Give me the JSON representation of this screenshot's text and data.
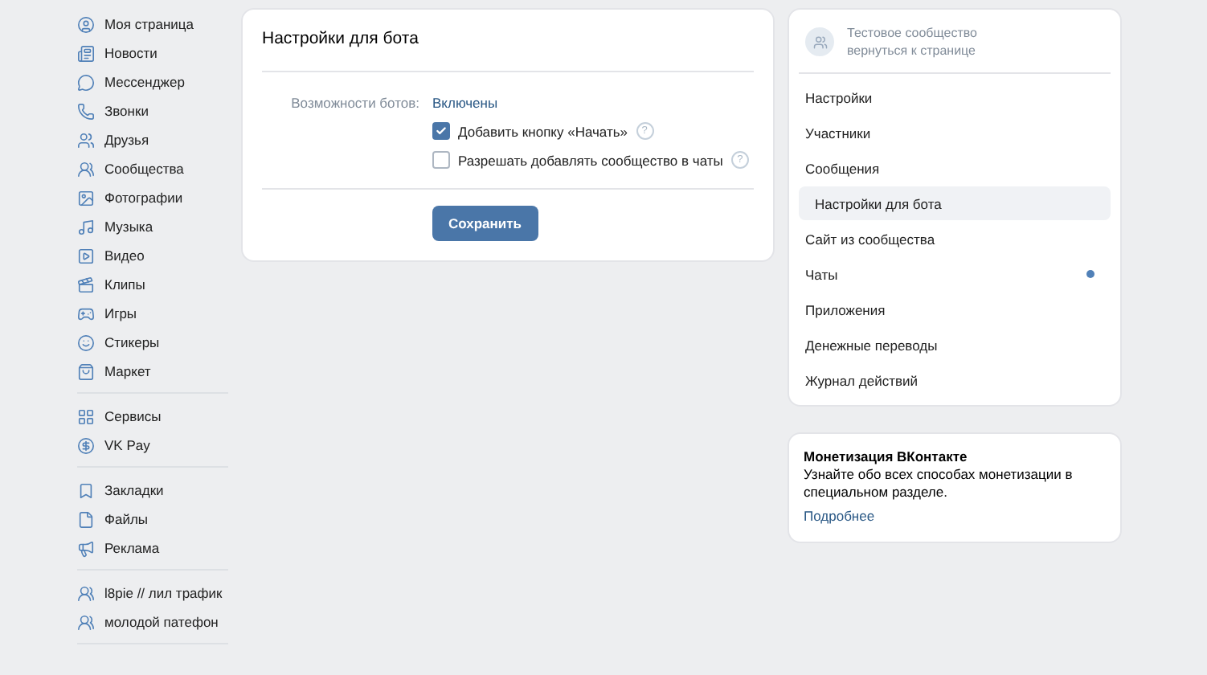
{
  "sidebar": {
    "groups": [
      {
        "items": [
          {
            "label": "Моя страница"
          },
          {
            "label": "Новости"
          },
          {
            "label": "Мессенджер"
          },
          {
            "label": "Звонки"
          },
          {
            "label": "Друзья"
          },
          {
            "label": "Сообщества"
          },
          {
            "label": "Фотографии"
          },
          {
            "label": "Музыка"
          },
          {
            "label": "Видео"
          },
          {
            "label": "Клипы"
          },
          {
            "label": "Игры"
          },
          {
            "label": "Стикеры"
          },
          {
            "label": "Маркет"
          }
        ]
      },
      {
        "items": [
          {
            "label": "Сервисы"
          },
          {
            "label": "VK Pay"
          }
        ]
      },
      {
        "items": [
          {
            "label": "Закладки"
          },
          {
            "label": "Файлы"
          },
          {
            "label": "Реклама"
          }
        ]
      },
      {
        "items": [
          {
            "label": "l8pie // лил трафик"
          },
          {
            "label": "молодой патефон"
          }
        ]
      }
    ]
  },
  "bot_settings": {
    "title": "Настройки для бота",
    "field_label": "Возможности ботов:",
    "field_value": "Включены",
    "options": [
      {
        "label": "Добавить кнопку «Начать»",
        "checked": true,
        "help": "?"
      },
      {
        "label": "Разрешать добавлять сообщество в чаты",
        "checked": false,
        "help": "?"
      }
    ],
    "save_button": "Сохранить"
  },
  "community": {
    "name": "Тестовое сообщество",
    "back_link": "вернуться к странице",
    "menu": [
      {
        "label": "Настройки",
        "selected": false,
        "unread": false
      },
      {
        "label": "Участники",
        "selected": false,
        "unread": false
      },
      {
        "label": "Сообщения",
        "selected": false,
        "unread": false
      },
      {
        "label": "Настройки для бота",
        "selected": true,
        "unread": false
      },
      {
        "label": "Сайт из сообщества",
        "selected": false,
        "unread": false
      },
      {
        "label": "Чаты",
        "selected": false,
        "unread": true
      },
      {
        "label": "Приложения",
        "selected": false,
        "unread": false
      },
      {
        "label": "Денежные переводы",
        "selected": false,
        "unread": false
      },
      {
        "label": "Журнал действий",
        "selected": false,
        "unread": false
      }
    ]
  },
  "promo": {
    "title": "Монетизация ВКонтакте",
    "text": "Узнайте обо всех способах монетизации в специальном разделе.",
    "link": "Подробнее"
  }
}
